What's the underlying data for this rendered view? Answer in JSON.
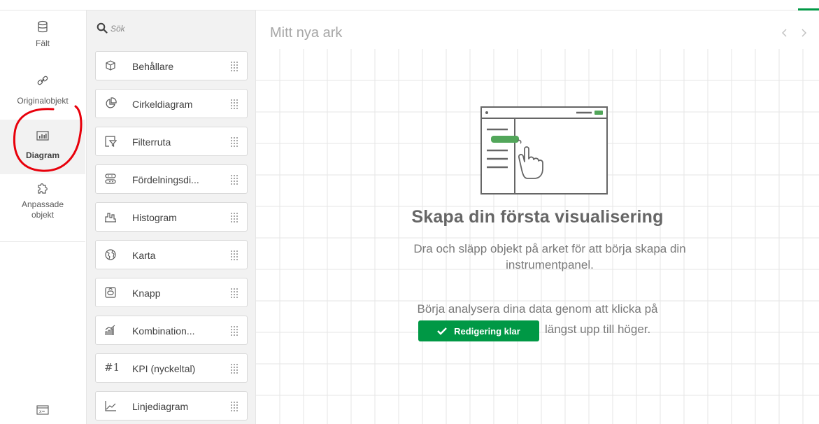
{
  "rail": {
    "items": [
      {
        "label": "Fält",
        "icon": "database-icon"
      },
      {
        "label": "Originalobjekt",
        "icon": "link-icon"
      },
      {
        "label": "Diagram",
        "icon": "bar-chart-icon",
        "active": true
      },
      {
        "label_line1": "Anpassade",
        "label_line2": "objekt",
        "icon": "puzzle-icon"
      }
    ],
    "bottom_icon": "variables-icon"
  },
  "search": {
    "placeholder": "Sök"
  },
  "objects": [
    {
      "label": "Behållare",
      "icon": "container-icon"
    },
    {
      "label": "Cirkeldiagram",
      "icon": "pie-chart-icon"
    },
    {
      "label": "Filterruta",
      "icon": "filter-pane-icon"
    },
    {
      "label": "Fördelningsdi...",
      "icon": "distribution-plot-icon"
    },
    {
      "label": "Histogram",
      "icon": "histogram-icon"
    },
    {
      "label": "Karta",
      "icon": "map-globe-icon"
    },
    {
      "label": "Knapp",
      "icon": "button-icon"
    },
    {
      "label": "Kombination...",
      "icon": "combo-chart-icon"
    },
    {
      "label": "KPI (nyckeltal)",
      "icon": "kpi-icon",
      "glyph": "#1"
    },
    {
      "label": "Linjediagram",
      "icon": "line-chart-icon"
    }
  ],
  "sheet": {
    "title": "Mitt nya ark",
    "empty_title": "Skapa din första visualisering",
    "empty_desc": "Dra och släpp objekt på arket för att börja skapa din instrumentpanel.",
    "hint_line1": "Börja analysera dina data genom att klicka på",
    "done_button": "Redigering klar",
    "hint_line2": "längst upp till höger."
  },
  "colors": {
    "accent": "#009845",
    "panel_bg": "#f2f2f2",
    "annotation": "#e8000b"
  }
}
